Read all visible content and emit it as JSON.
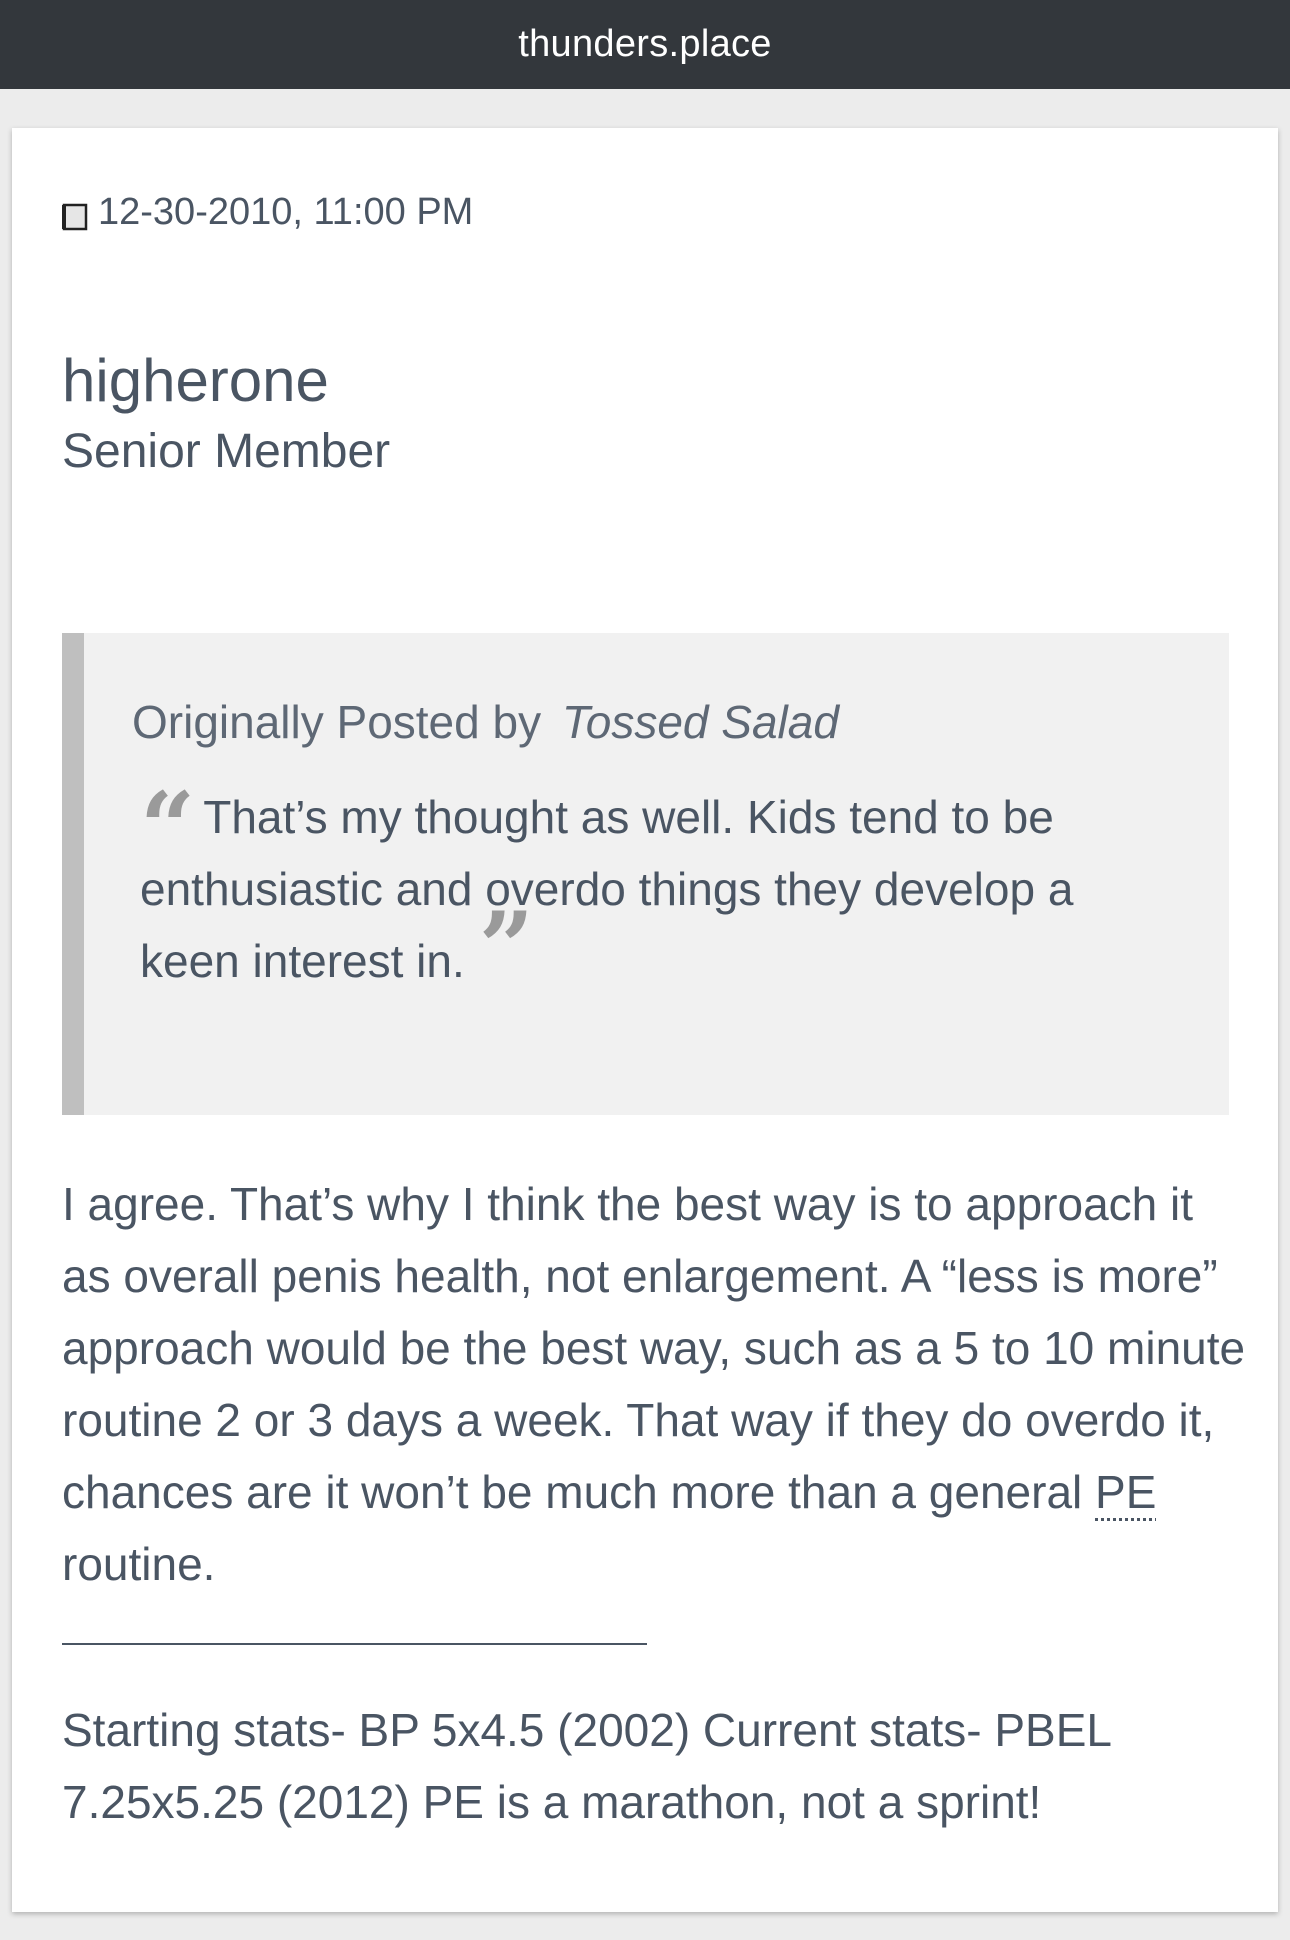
{
  "browser": {
    "domain": "thunders.place"
  },
  "post": {
    "date": "12-30-2010, 11:00 PM",
    "author": "higherone",
    "author_title": "Senior Member",
    "quote": {
      "prefix": "Originally Posted by",
      "author": "Tossed Salad",
      "open_mark": "“",
      "text": "That’s my thought as well. Kids tend to be enthusiastic and overdo things they develop a keen interest in.",
      "close_mark": "”"
    },
    "body": {
      "text_before": "I agree. That’s why I think the best way is to approach it as overall penis health, not enlargement. A “less is more” approach would be the best way, such as a 5 to 10 minute routine 2 or 3 days a week. That way if they do overdo it, chances are it won’t be much more than a general ",
      "abbr": "PE",
      "text_after": " routine."
    },
    "signature": "Starting stats- BP 5x4.5 (2002) Current stats- PBEL 7.25x5.25 (2012) PE is a marathon, not a sprint!"
  }
}
